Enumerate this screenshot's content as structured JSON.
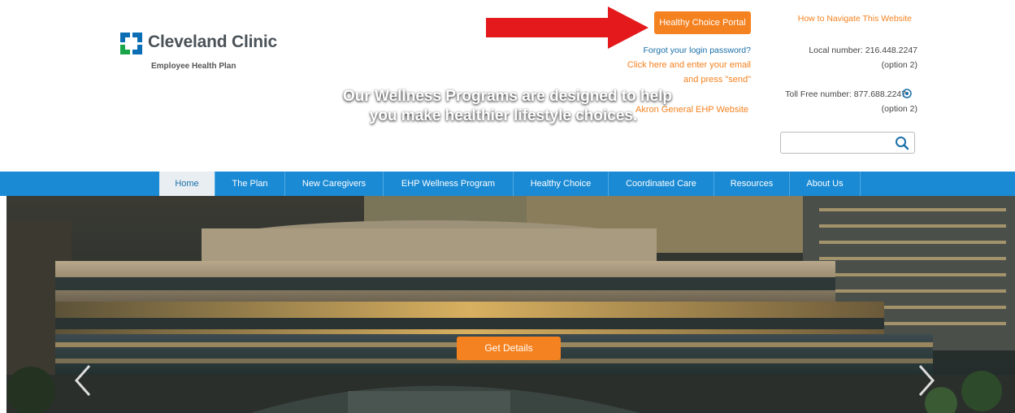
{
  "logo": {
    "title": "Cleveland Clinic",
    "subtitle": "Employee Health Plan"
  },
  "header": {
    "portal_button": "Healthy Choice Portal",
    "forgot_password": "Forgot your login password?",
    "click_here_1": "Click here and enter your email",
    "click_here_2": "and press \"send\"",
    "akron_link": "Akron General EHP Website",
    "navigate_link": "How to Navigate This Website",
    "local_number": "Local number: 216.448.2247",
    "local_option": "(option 2)",
    "tollfree_number": "Toll Free number: 877.688.2247",
    "tollfree_option": "(option 2)"
  },
  "search": {
    "placeholder": ""
  },
  "nav": {
    "items": [
      "Home",
      "The Plan",
      "New Caregivers",
      "EHP Wellness Program",
      "Healthy Choice",
      "Coordinated Care",
      "Resources",
      "About Us"
    ]
  },
  "hero": {
    "line1": "Our Wellness Programs are designed to help",
    "line2": "you make healthier lifestyle choices.",
    "button": "Get Details"
  },
  "colors": {
    "brand_blue": "#1a8ad4",
    "accent_orange": "#f58220",
    "arrow_red": "#e3191c"
  }
}
